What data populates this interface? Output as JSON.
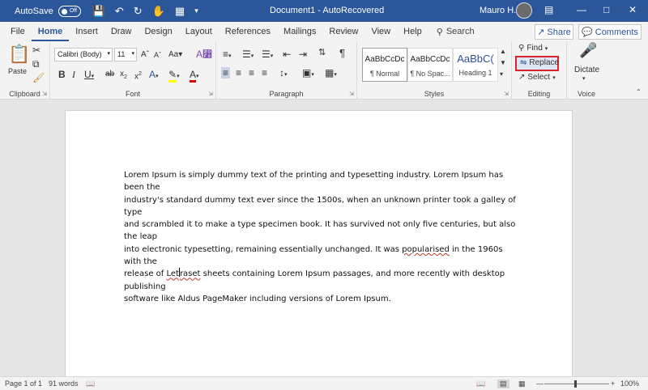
{
  "titlebar": {
    "autosave_label": "AutoSave",
    "autosave_state": "Off",
    "title": "Document1  -  AutoRecovered",
    "user": "Mauro H.",
    "bg_color": "#2b579a"
  },
  "menu": {
    "tabs": [
      "File",
      "Home",
      "Insert",
      "Draw",
      "Design",
      "Layout",
      "References",
      "Mailings",
      "Review",
      "View",
      "Help"
    ],
    "active_tab": "Home",
    "search_label": "Search",
    "share_label": "Share",
    "comments_label": "Comments"
  },
  "ribbon": {
    "clipboard": {
      "label": "Clipboard",
      "paste_label": "Paste"
    },
    "font": {
      "label": "Font",
      "font_name": "Calibri (Body)",
      "font_size": "11"
    },
    "paragraph": {
      "label": "Paragraph"
    },
    "styles": {
      "label": "Styles",
      "items": [
        {
          "preview": "AaBbCcDc",
          "name": "¶ Normal"
        },
        {
          "preview": "AaBbCcDc",
          "name": "¶ No Spac..."
        },
        {
          "preview": "AaBbC(",
          "name": "Heading 1"
        }
      ]
    },
    "editing": {
      "label": "Editing",
      "find_label": "Find",
      "replace_label": "Replace",
      "select_label": "Select"
    },
    "voice": {
      "label": "Voice",
      "dictate_label": "Dictate"
    }
  },
  "document": {
    "lines": [
      "Lorem Ipsum is simply dummy text of the printing and typesetting industry. Lorem Ipsum has been the",
      "industry's standard dummy text ever since the 1500s, when an unknown printer took a galley of type",
      "and scrambled it to make a type specimen book. It has survived not only five centuries, but also the leap",
      "into electronic typesetting, remaining essentially unchanged. It was "
    ],
    "misspelled_1": "popularised",
    "line4_tail": " in the 1960s with the",
    "line5_head": "release of ",
    "misspelled_2a": "Let",
    "misspelled_2b": "raset",
    "line5_tail": " sheets containing Lorem Ipsum passages, and more recently with desktop publishing",
    "line6": "software like Aldus PageMaker including versions of Lorem Ipsum."
  },
  "status": {
    "page": "Page 1 of 1",
    "words": "91 words",
    "zoom": "100%"
  }
}
